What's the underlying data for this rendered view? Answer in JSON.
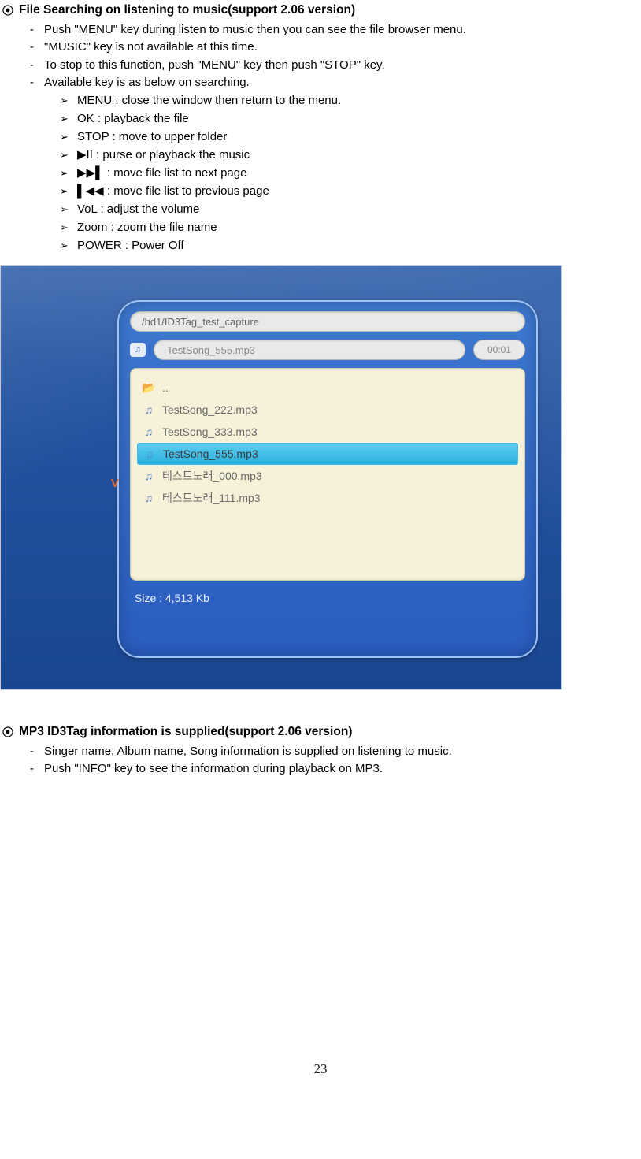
{
  "section1": {
    "title": "File Searching on listening to music(support 2.06 version)",
    "dashes": [
      "Push \"MENU\" key during listen to music then you can see the file browser menu.",
      "\"MUSIC\" key is not available at this time.",
      "To stop to this function, push \"MENU\" key then push \"STOP\" key.",
      "Available key is as below on searching."
    ],
    "chevs": [
      "MENU : close the window then return to the menu.",
      "OK : playback the file",
      "STOP : move to upper folder",
      "▶II : purse or playback the music",
      "▶▶▌ :  move file list to next page",
      "▌◀◀ :   move file list to previous page",
      "VoL : adjust the volume",
      "Zoom : zoom the file name",
      "POWER : Power Off"
    ]
  },
  "browser": {
    "path": "/hd1/ID3Tag_test_capture",
    "now_playing": "TestSong_555.mp3",
    "time": "00:01",
    "up_label": "..",
    "files": [
      "TestSong_222.mp3",
      "TestSong_333.mp3",
      "TestSong_555.mp3",
      "테스트노래_000.mp3",
      "테스트노래_111.mp3"
    ],
    "selected_index": 2,
    "v_mark": "V",
    "size_label": "Size : 4,513 Kb"
  },
  "section2": {
    "title": "MP3 ID3Tag information is supplied(support 2.06 version)",
    "dashes": [
      "Singer name, Album name, Song information is supplied on listening to music.",
      "Push \"INFO\" key to see the information during playback on MP3."
    ]
  },
  "page_number": "23"
}
